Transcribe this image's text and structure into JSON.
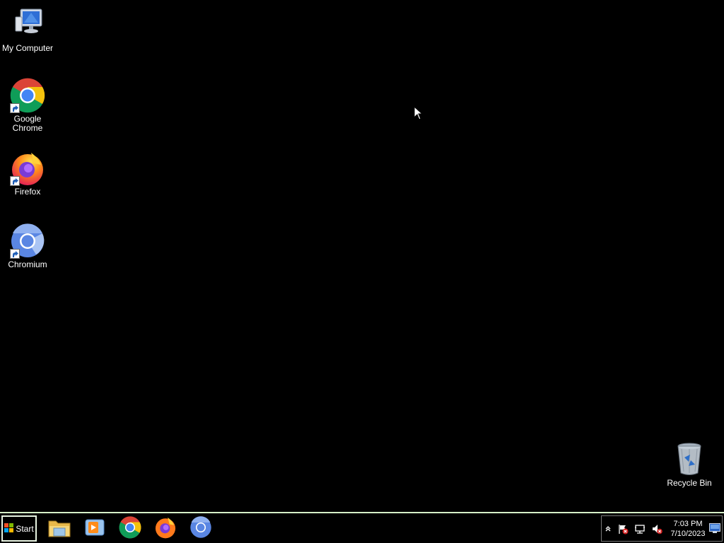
{
  "desktop": {
    "icons": [
      {
        "label": "My Computer",
        "icon": "my-computer-icon"
      },
      {
        "label": "Google Chrome",
        "icon": "chrome-icon",
        "shortcut": true
      },
      {
        "label": "Firefox",
        "icon": "firefox-icon",
        "shortcut": true
      },
      {
        "label": "Chromium",
        "icon": "chromium-icon",
        "shortcut": true
      },
      {
        "label": "Recycle Bin",
        "icon": "recycle-bin-icon"
      }
    ]
  },
  "taskbar": {
    "start_label": "Start",
    "pinned": [
      "file-explorer-icon",
      "media-player-icon",
      "chrome-icon",
      "firefox-icon",
      "chromium-icon"
    ],
    "tray": {
      "icons": [
        "show-hidden-icons-chevron",
        "action-center-flag-icon",
        "network-icon",
        "volume-muted-icon"
      ],
      "time": "7:03 PM",
      "date": "7/10/2023"
    }
  },
  "colors": {
    "desktop_background": "#000000",
    "taskbar_border": "#d6f0c8"
  }
}
